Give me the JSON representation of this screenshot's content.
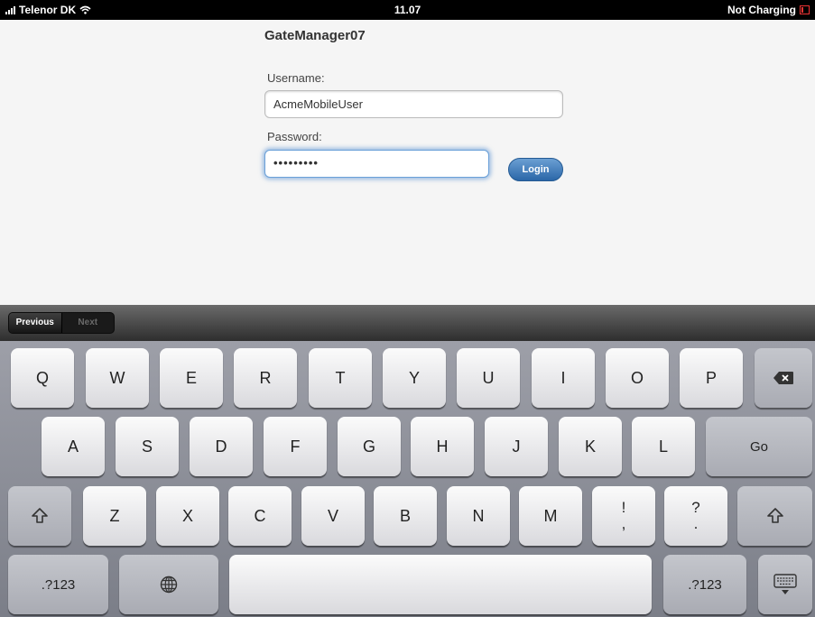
{
  "status_bar": {
    "carrier": "Telenor DK",
    "time": "11.07",
    "battery_status": "Not Charging"
  },
  "login": {
    "title": "GateManager07",
    "username_label": "Username:",
    "username_value": "AcmeMobileUser",
    "password_label": "Password:",
    "password_value": "•••••••••",
    "login_label": "Login"
  },
  "form_assistant": {
    "previous_label": "Previous",
    "next_label": "Next"
  },
  "keyboard": {
    "row1": [
      "Q",
      "W",
      "E",
      "R",
      "T",
      "Y",
      "U",
      "I",
      "O",
      "P"
    ],
    "row2": [
      "A",
      "S",
      "D",
      "F",
      "G",
      "H",
      "J",
      "K",
      "L"
    ],
    "go_label": "Go",
    "row3": [
      "Z",
      "X",
      "C",
      "V",
      "B",
      "N",
      "M"
    ],
    "punct1": {
      "top": "!",
      "bottom": ","
    },
    "punct2": {
      "top": "?",
      "bottom": "."
    },
    "numbers_label": ".?123",
    "icons": {
      "delete": "delete-icon",
      "shift": "shift-icon",
      "globe": "globe-icon",
      "hide_keyboard": "keyboard-hide-icon",
      "wifi": "wifi-icon",
      "signal": "signal-icon",
      "battery": "battery-icon"
    }
  }
}
